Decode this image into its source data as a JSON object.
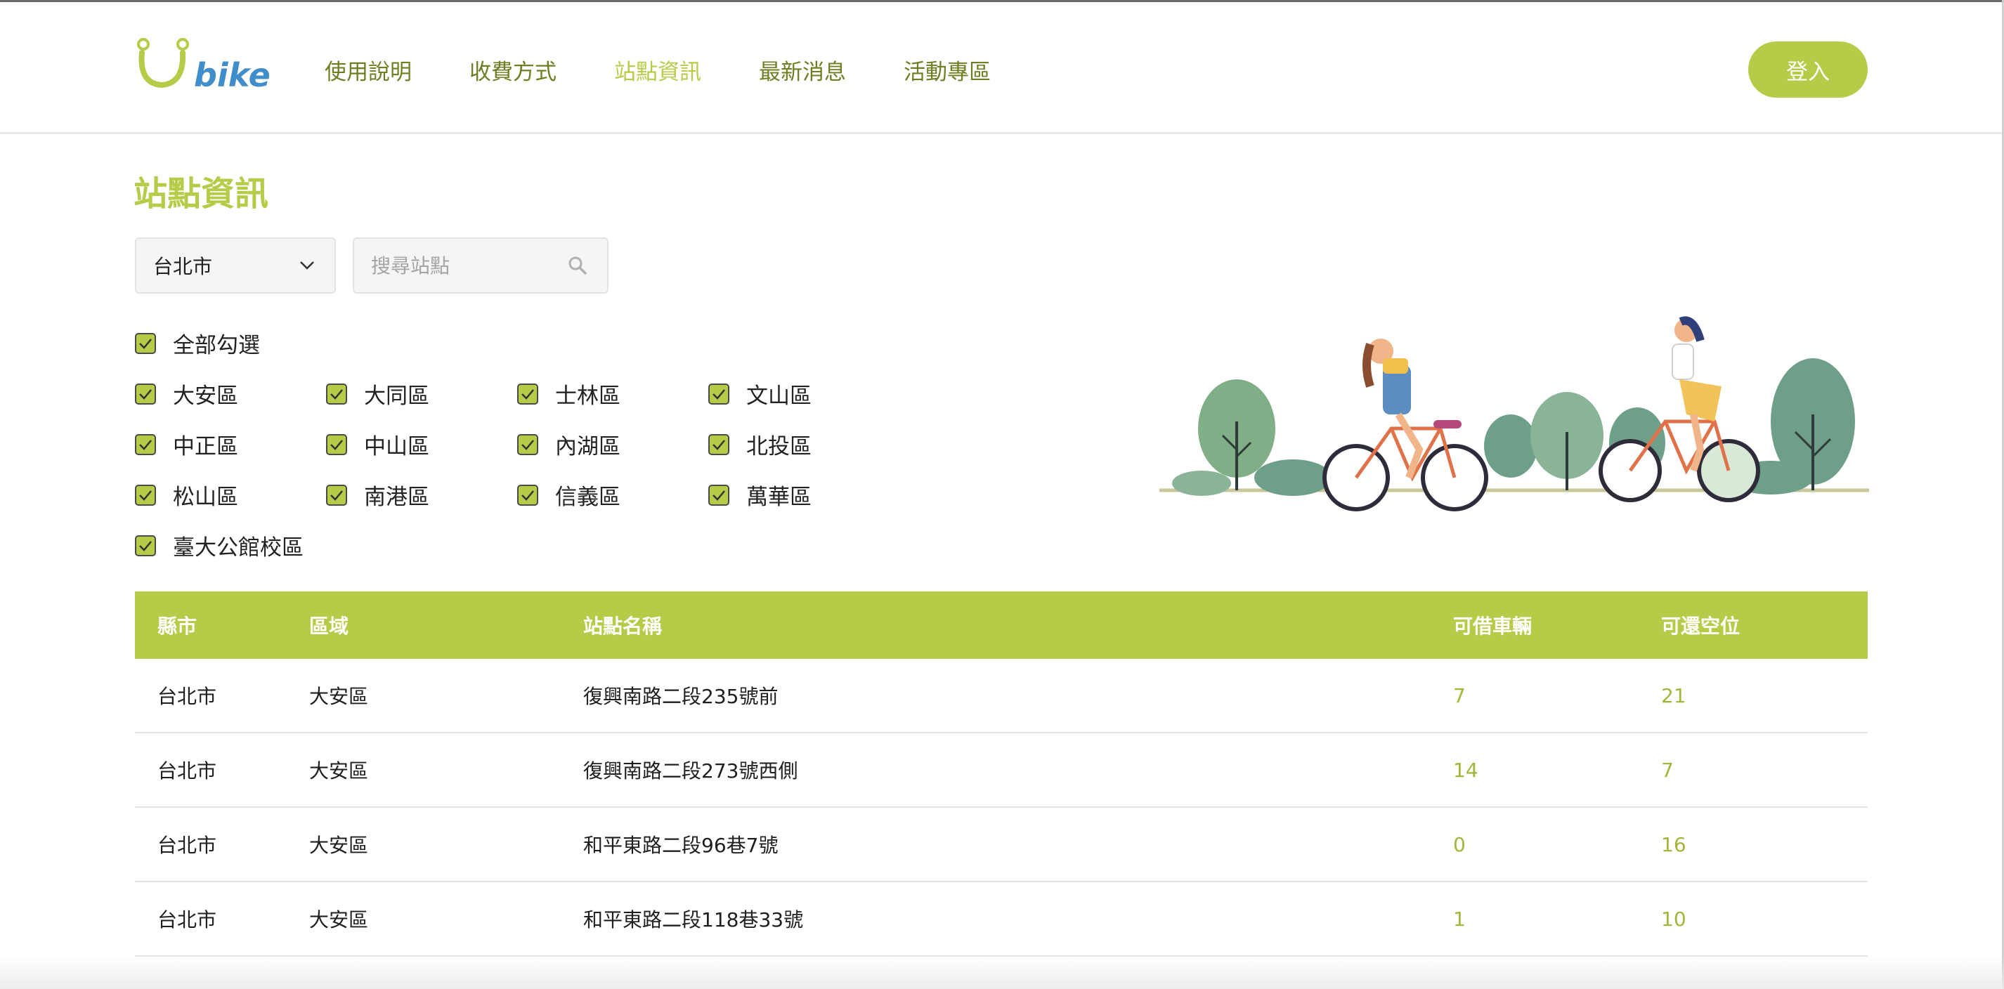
{
  "brand": {
    "logo_text": "bike",
    "accent_color": "#b6cb48",
    "nav_color": "#6f7e22"
  },
  "nav": {
    "items": [
      {
        "label": "使用說明",
        "active": false
      },
      {
        "label": "收費方式",
        "active": false
      },
      {
        "label": "站點資訊",
        "active": true
      },
      {
        "label": "最新消息",
        "active": false
      },
      {
        "label": "活動專區",
        "active": false
      }
    ],
    "login_label": "登入"
  },
  "page": {
    "title": "站點資訊"
  },
  "filters": {
    "city_selected": "台北市",
    "search_placeholder": "搜尋站點",
    "select_all_label": "全部勾選",
    "districts": [
      {
        "label": "大安區",
        "checked": true
      },
      {
        "label": "大同區",
        "checked": true
      },
      {
        "label": "士林區",
        "checked": true
      },
      {
        "label": "文山區",
        "checked": true
      },
      {
        "label": "中正區",
        "checked": true
      },
      {
        "label": "中山區",
        "checked": true
      },
      {
        "label": "內湖區",
        "checked": true
      },
      {
        "label": "北投區",
        "checked": true
      },
      {
        "label": "松山區",
        "checked": true
      },
      {
        "label": "南港區",
        "checked": true
      },
      {
        "label": "信義區",
        "checked": true
      },
      {
        "label": "萬華區",
        "checked": true
      },
      {
        "label": "臺大公館校區",
        "checked": true
      }
    ]
  },
  "table": {
    "headers": {
      "city": "縣市",
      "area": "區域",
      "name": "站點名稱",
      "available_bikes": "可借車輛",
      "available_docks": "可還空位"
    },
    "rows": [
      {
        "city": "台北市",
        "area": "大安區",
        "name": "復興南路二段235號前",
        "bikes": "7",
        "docks": "21"
      },
      {
        "city": "台北市",
        "area": "大安區",
        "name": "復興南路二段273號西側",
        "bikes": "14",
        "docks": "7"
      },
      {
        "city": "台北市",
        "area": "大安區",
        "name": "和平東路二段96巷7號",
        "bikes": "0",
        "docks": "16"
      },
      {
        "city": "台北市",
        "area": "大安區",
        "name": "和平東路二段118巷33號",
        "bikes": "1",
        "docks": "10"
      }
    ]
  },
  "icons": {
    "search": "search-icon",
    "chevron": "chevron-down-icon",
    "check": "check-icon"
  }
}
